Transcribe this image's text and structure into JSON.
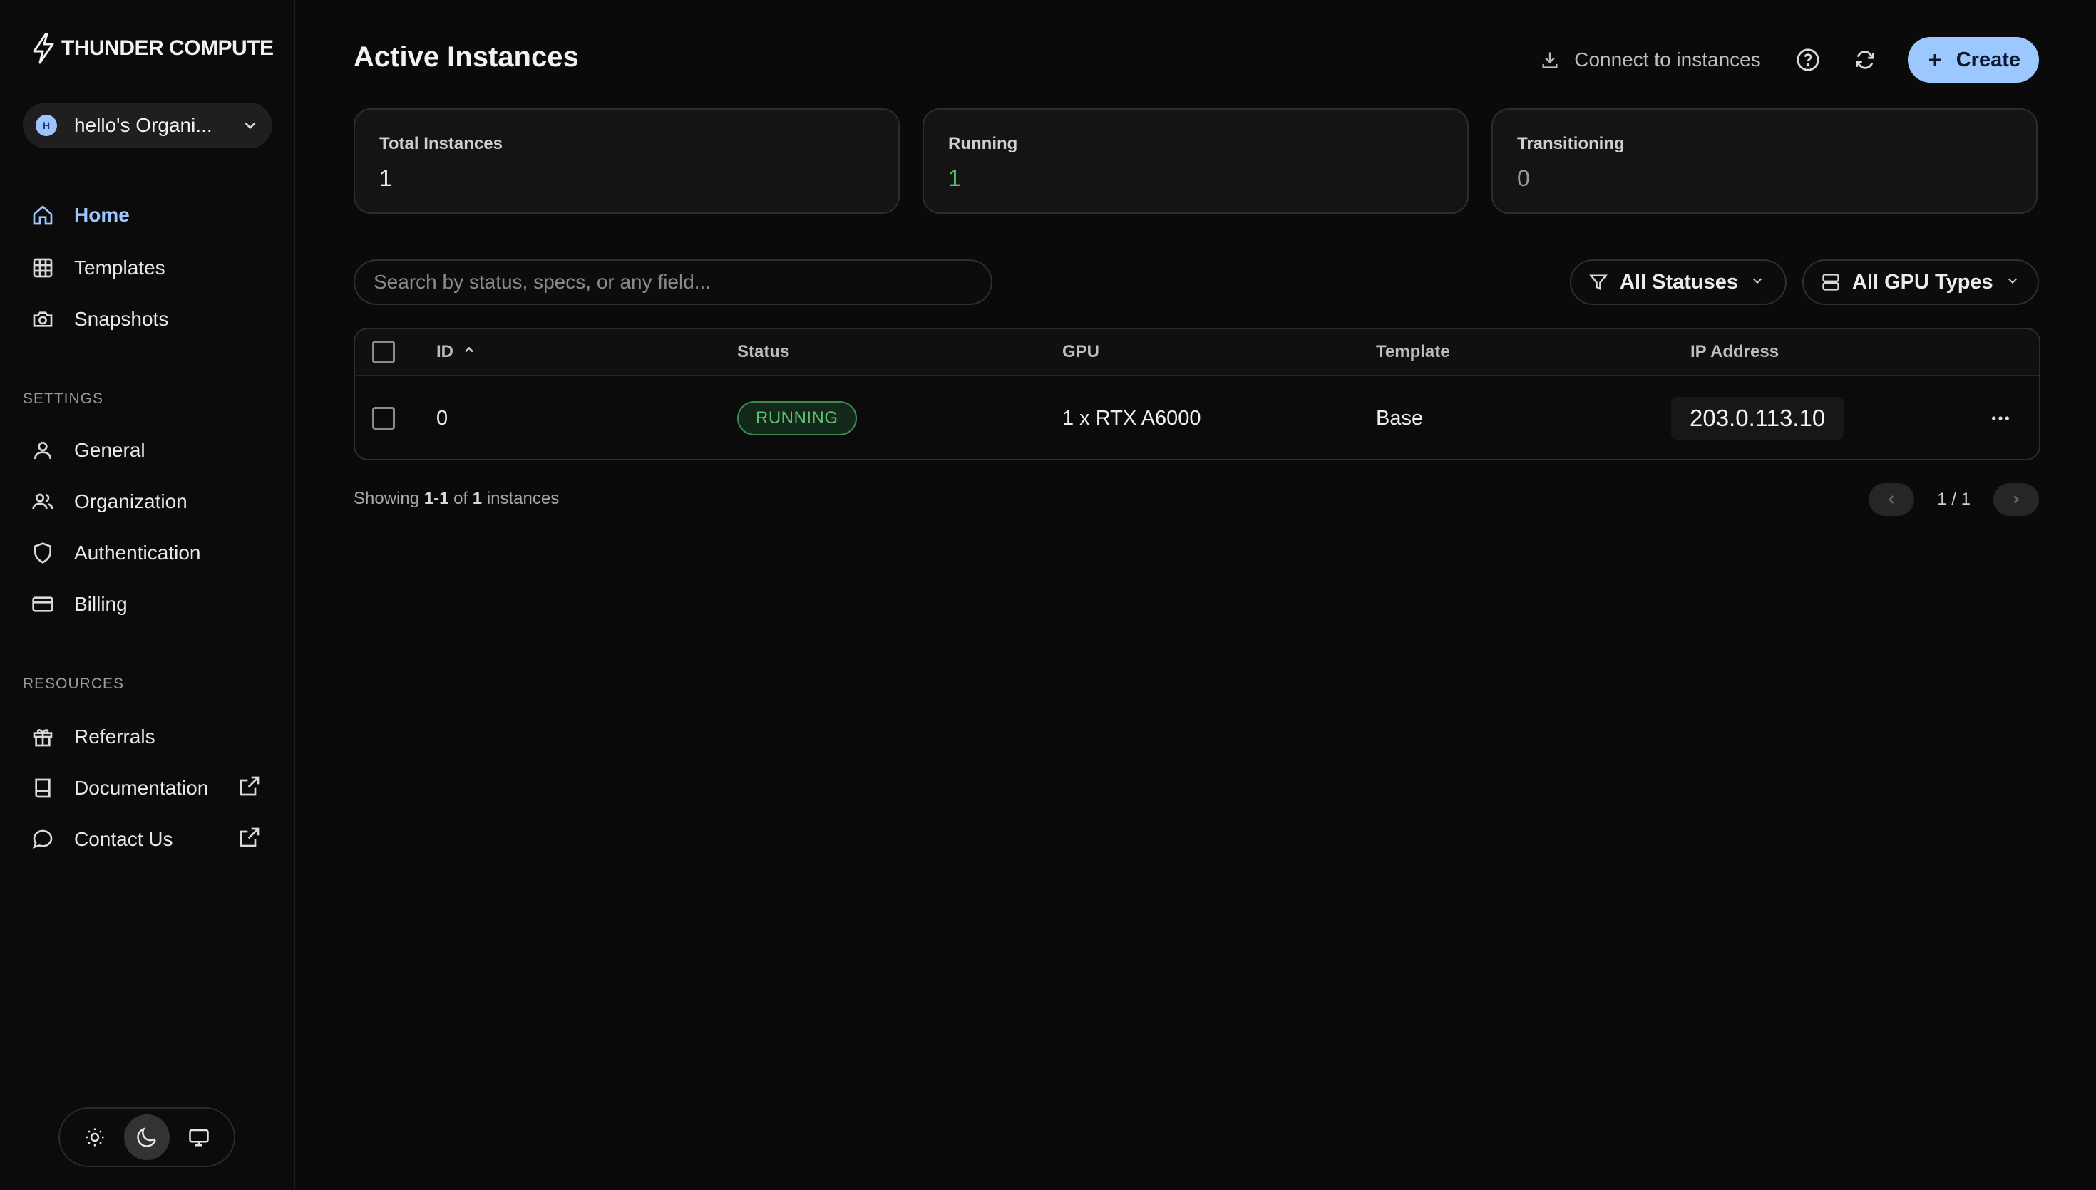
{
  "brand": {
    "name": "THUNDER COMPUTE",
    "accent": "#9cc8ff"
  },
  "org": {
    "avatar_letter": "H",
    "name": "hello's Organi..."
  },
  "nav": {
    "main": [
      {
        "label": "Home",
        "icon": "home-icon",
        "active": true
      },
      {
        "label": "Templates",
        "icon": "grid-icon"
      },
      {
        "label": "Snapshots",
        "icon": "camera-icon"
      }
    ],
    "settings_label": "SETTINGS",
    "settings": [
      {
        "label": "General",
        "icon": "user-icon"
      },
      {
        "label": "Organization",
        "icon": "users-icon"
      },
      {
        "label": "Authentication",
        "icon": "shield-icon"
      },
      {
        "label": "Billing",
        "icon": "credit-card-icon"
      }
    ],
    "resources_label": "RESOURCES",
    "resources": [
      {
        "label": "Referrals",
        "icon": "gift-icon"
      },
      {
        "label": "Documentation",
        "icon": "book-icon",
        "external": true
      },
      {
        "label": "Contact Us",
        "icon": "message-icon",
        "external": true
      }
    ]
  },
  "theme": {
    "options": [
      "light",
      "dark",
      "system"
    ],
    "selected": "dark"
  },
  "header": {
    "title": "Active Instances",
    "connect_label": "Connect to instances",
    "create_label": "Create"
  },
  "stats": [
    {
      "label": "Total Instances",
      "value": "1"
    },
    {
      "label": "Running",
      "value": "1",
      "color": "#5ec26a"
    },
    {
      "label": "Transitioning",
      "value": "0"
    }
  ],
  "search": {
    "placeholder": "Search by status, specs, or any field...",
    "value": ""
  },
  "filters": {
    "status": "All Statuses",
    "gpu": "All GPU Types"
  },
  "table": {
    "columns": [
      "ID",
      "Status",
      "GPU",
      "Template",
      "IP Address"
    ],
    "sort": {
      "column": "ID",
      "direction": "asc"
    },
    "rows": [
      {
        "id": "0",
        "status": "RUNNING",
        "gpu": "1 x RTX A6000",
        "template": "Base",
        "ip": "203.0.113.10"
      }
    ]
  },
  "footer": {
    "showing_prefix": "Showing",
    "range": "1-1",
    "of_word": "of",
    "total": "1",
    "unit": "instances",
    "page_indicator": "1 / 1"
  }
}
